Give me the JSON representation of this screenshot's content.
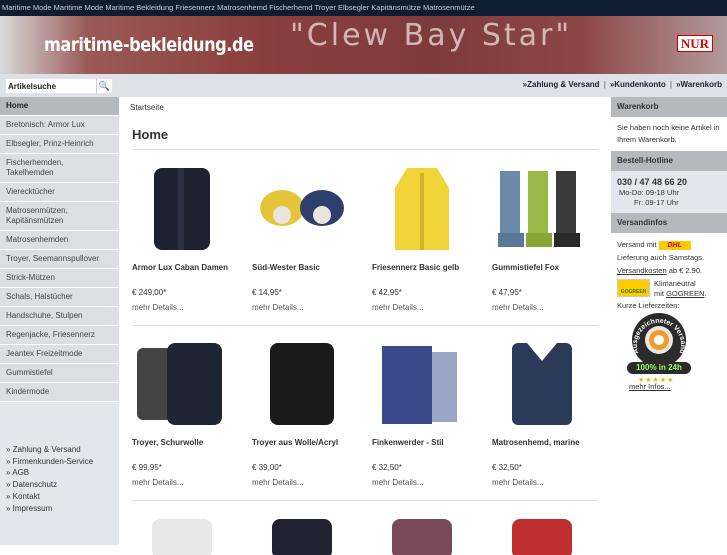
{
  "topbar": "Maritime Mode Maritime Mode Maritime Bekleidung Friesennerz Matrosenhemd Fischerhemd Troyer Elbsegler Kapitänsmütze Matrosenmütze",
  "banner": {
    "logo": "maritime-bekleidung.de",
    "deco": "\"Clew Bay Star\"",
    "badge": "NUR"
  },
  "search": {
    "value": "Artikelsuche"
  },
  "toplinks": [
    "»Zahlung & Versand",
    "»Kundenkonto",
    "»Warenkorb"
  ],
  "categories": [
    "Home",
    "Bretonisch: Armor Lux",
    "Elbsegler, Prinz-Heinrich",
    "Fischerhemden, Takelhemden",
    "Vierecktücher",
    "Matrosenmützen, Kapitänsmützen",
    "Matrosenhemden",
    "Troyer, Seemannspullover",
    "Strick-Mützen",
    "Schals, Halstücher",
    "Handschuhe, Stulpen",
    "Regenjacke, Friesennerz",
    "Jeantex Freizeitmode",
    "Gummistiefel",
    "Kindermode"
  ],
  "footer_links": [
    "» Zahlung & Versand",
    "» Firmenkunden-Service",
    "» AGB",
    "» Datenschutz",
    "» Kontakt",
    "» Impressum"
  ],
  "breadcrumb": "Startseite",
  "page_title": "Home",
  "details_label": "mehr Details...",
  "products": [
    {
      "name": "Armor Lux Caban Damen",
      "price": "€ 249,00*"
    },
    {
      "name": "Süd-Wester Basic",
      "price": "€ 14,95*"
    },
    {
      "name": "Friesennerz Basic gelb",
      "price": "€ 42,95*"
    },
    {
      "name": "Gummistiefel Fox",
      "price": "€ 47,95*"
    },
    {
      "name": "Troyer, Schurwolle",
      "price": "€ 99,95*"
    },
    {
      "name": "Troyer aus Wolle/Acryl",
      "price": "€ 39,00*"
    },
    {
      "name": "Finkenwerder - Stil",
      "price": "€ 32,50*"
    },
    {
      "name": "Matrosenhemd, marine",
      "price": "€ 32,50*"
    }
  ],
  "cart": {
    "title": "Warenkorb",
    "text": "Sie haben noch keine Artikel in Ihrem Warenkorb."
  },
  "hotline": {
    "title": "Bestell-Hotline",
    "phone": "030 / 47 48 66 20",
    "hours1": "Mo-Do: 09-18 Uhr",
    "hours2": "Fr: 09-17 Uhr"
  },
  "shipping": {
    "title": "Versandinfos",
    "line1": "Versand mit",
    "dhl": "DHL",
    "line2": "Lieferung auch Samstags.",
    "costs_link": "Versandkosten",
    "costs_rest": " ab € 2.90.",
    "gogreen_badge": "GOGREEN",
    "klima": "Klimaneutral",
    "mit": "mit ",
    "gogreen_link": "GOGREEN",
    "gogreen_end": ".",
    "kurze": "Kurze Lieferzeiten:",
    "seal_text": "Ausgezeichneter Versand",
    "seal_badge": "100% in 24h",
    "more": "mehr Infos..."
  }
}
